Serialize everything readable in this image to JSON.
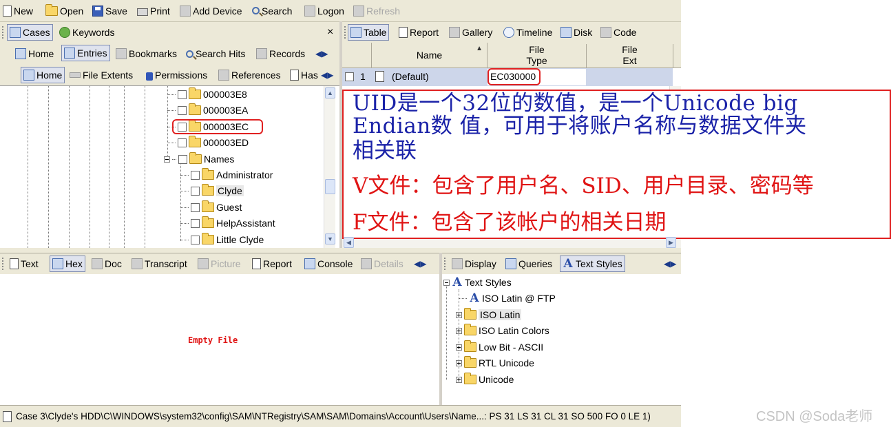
{
  "main_toolbar": {
    "new": "New",
    "open": "Open",
    "save": "Save",
    "print": "Print",
    "add_device": "Add Device",
    "search": "Search",
    "logon": "Logon",
    "refresh": "Refresh"
  },
  "left_pane": {
    "top_tabs": {
      "cases": "Cases",
      "keywords": "Keywords",
      "close": "×"
    },
    "view_tabs": {
      "home": "Home",
      "entries": "Entries",
      "bookmarks": "Bookmarks",
      "search_hits": "Search Hits",
      "records": "Records"
    },
    "sub_tabs": {
      "home": "Home",
      "file_extents": "File Extents",
      "permissions": "Permissions",
      "references": "References",
      "hash": "Has"
    },
    "tree": {
      "key_3e8": "000003E8",
      "key_3ea": "000003EA",
      "key_3ec": "000003EC",
      "key_3ed": "000003ED",
      "names": "Names",
      "administrator": "Administrator",
      "clyde": "Clyde",
      "guest": "Guest",
      "helpassistant": "HelpAssistant",
      "little_clyde": "Little Clyde"
    }
  },
  "right_pane": {
    "tabs": {
      "table": "Table",
      "report": "Report",
      "gallery": "Gallery",
      "timeline": "Timeline",
      "disk": "Disk",
      "code": "Code"
    },
    "columns": {
      "name": "Name",
      "file_type_1": "File",
      "file_type_2": "Type",
      "file_ext_1": "File",
      "file_ext_2": "Ext"
    },
    "row": {
      "index": "1",
      "name": "(Default)",
      "file_type": "EC030000"
    }
  },
  "annotation": {
    "line1": "UID是一个32位的数值，是一个Unicode big",
    "line2": "Endian数 值，可用于将账户名称与数据文件夹",
    "line3": "相关联",
    "line4": "V文件：包含了用户名、SID、用户目录、密码等",
    "line5": "F文件：包含了该帐户的相关日期",
    "colors": {
      "blue": "#1a22a8",
      "red": "#e01414"
    }
  },
  "bottom_left": {
    "tabs": {
      "text": "Text",
      "hex": "Hex",
      "doc": "Doc",
      "transcript": "Transcript",
      "picture": "Picture",
      "report": "Report",
      "console": "Console",
      "details": "Details"
    },
    "empty_message": "Empty File"
  },
  "bottom_right": {
    "tabs": {
      "display": "Display",
      "queries": "Queries",
      "text_styles": "Text Styles"
    },
    "tree": {
      "root": "Text Styles",
      "iso_latin_ftp": "ISO Latin @ FTP",
      "iso_latin": "ISO Latin",
      "iso_latin_colors": "ISO Latin Colors",
      "low_bit": "Low Bit - ASCII",
      "rtl_unicode": "RTL Unicode",
      "unicode": "Unicode"
    }
  },
  "status_bar": {
    "path": "Case 3\\Clyde's HDD\\C\\WINDOWS\\system32\\config\\SAM\\NTRegistry\\SAM\\SAM\\Domains\\Account\\Users\\Name...: PS 31  LS 31  CL 31  SO 500  FO 0  LE 1)"
  },
  "watermark": "CSDN @Soda老师"
}
